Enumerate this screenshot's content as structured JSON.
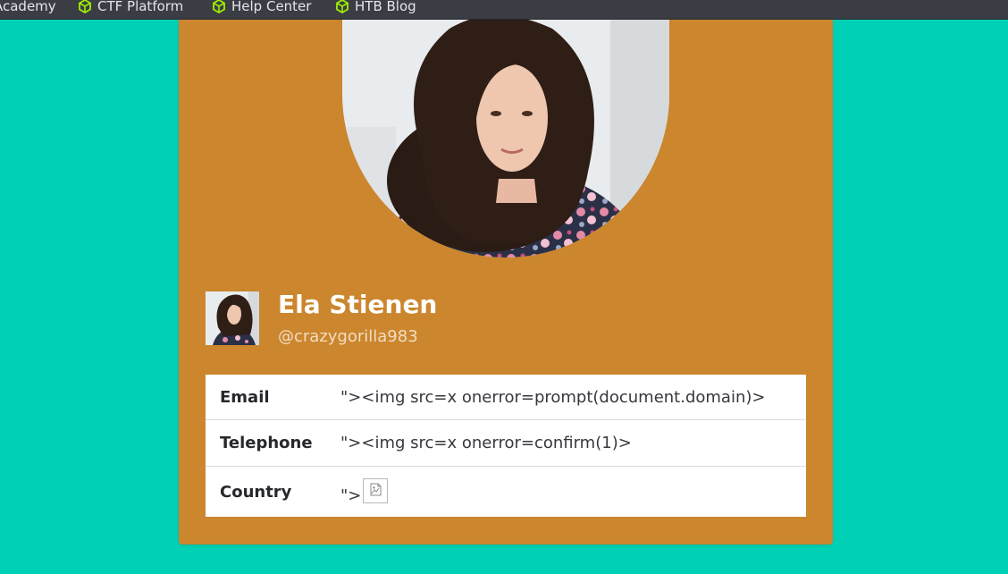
{
  "bookmarks_bar": {
    "items": [
      {
        "label": "Academy",
        "icon": "none"
      },
      {
        "label": "CTF Platform",
        "icon": "htb-cube-icon"
      },
      {
        "label": "Help Center",
        "icon": "htb-cube-icon"
      },
      {
        "label": "HTB Blog",
        "icon": "htb-cube-icon"
      }
    ]
  },
  "profile": {
    "name": "Ela Stienen",
    "username": "@crazygorilla983"
  },
  "details": [
    {
      "label": "Email",
      "value": "\"><img src=x onerror=prompt(document.domain)>"
    },
    {
      "label": "Telephone",
      "value": "\"><img src=x onerror=confirm(1)>"
    },
    {
      "label": "Country",
      "value": "\">"
    }
  ],
  "colors": {
    "page_background": "#00d1b6",
    "card_background": "#cb862e",
    "bookmark_icon": "#9fef00",
    "bookmarks_bar": "#3b3d45"
  }
}
